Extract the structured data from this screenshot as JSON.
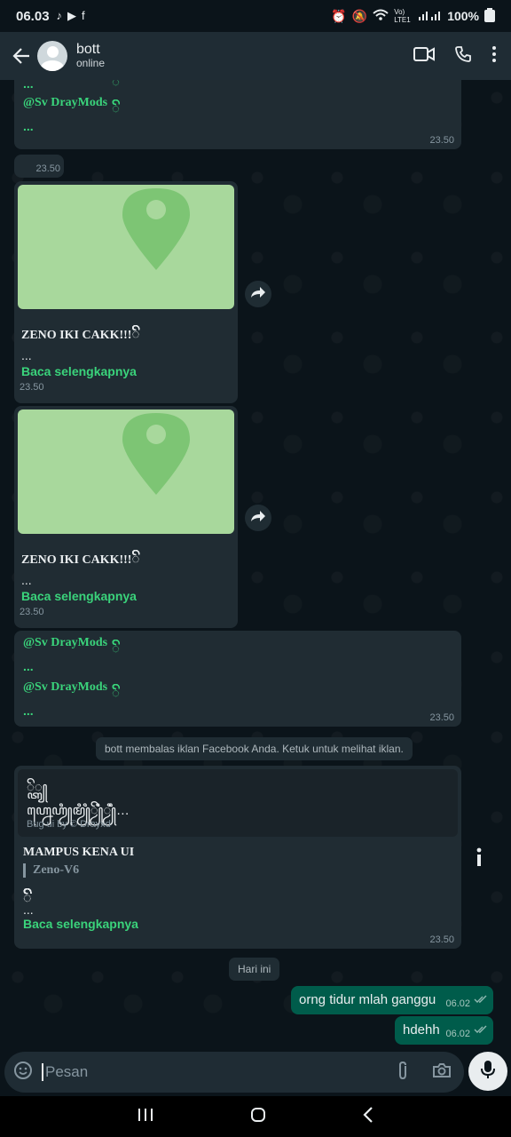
{
  "status_bar": {
    "time": "06.03",
    "battery": "100%",
    "signal": "Vo) LTE1"
  },
  "header": {
    "name": "bott",
    "status": "online"
  },
  "messages": {
    "top_bubble": {
      "line1_dots": "...",
      "mention": "@Sv DrayMods",
      "dots": "...",
      "time": "23.50"
    },
    "deleted_bubble_time": "23.50",
    "loc1": {
      "title": "ZENO IKI CAKK!!!",
      "dots": "...",
      "baca": "Baca selengkapnya",
      "time": "23.50"
    },
    "loc2": {
      "title": "ZENO IKI CAKK!!!",
      "dots": "...",
      "baca": "Baca selengkapnya",
      "time": "23.50"
    },
    "mentions_bubble": {
      "mention1": "@Sv DrayMods",
      "dots1": "...",
      "mention2": "@Sv DrayMods",
      "dots2": "...",
      "time": "23.50"
    },
    "system_notice": "bott membalas iklan Facebook Anda. Ketuk untuk melihat iklan.",
    "ad_bubble": {
      "line1": "ꦼ꧀ꦠꦾ",
      "line2": "ꦲ꧀ꦤꦺꦲꦾꦶꦩꦾꦶꦶꦾꦼꦶꦾꦶꦶ…",
      "credit": "Bug ui by © Drayxd",
      "title": "MAMPUS KENA UI",
      "quote": "Zeno-V6",
      "dots": "...",
      "baca": "Baca selengkapnya",
      "time": "23.50"
    },
    "day_divider": "Hari ini",
    "out1": {
      "text": "orng tidur mlah ganggu",
      "time": "06.02"
    },
    "out2": {
      "text": "hdehh",
      "time": "06.02"
    }
  },
  "input": {
    "placeholder": "Pesan"
  },
  "colors": {
    "accent_green": "#3ad37b",
    "bubble_in": "#202c33",
    "bubble_out": "#005c4b",
    "map": "#a8d89c"
  }
}
